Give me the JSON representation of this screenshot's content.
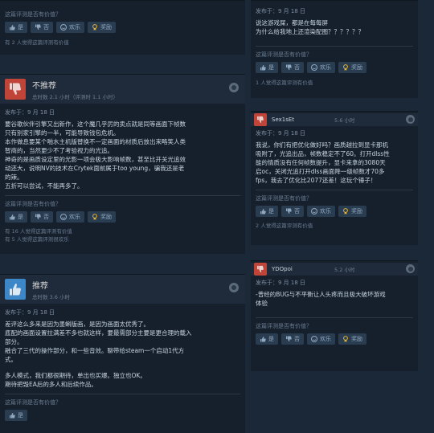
{
  "vote": {
    "question": "这篇评测是否有价值？",
    "yes": "是",
    "no": "否",
    "funny": "欢乐",
    "award": "奖励"
  },
  "top_left": {
    "stats": "有 2 人觉得这篇评测有价值"
  },
  "review1": {
    "verdict": "不推荐",
    "hours": "总时数 2.1 小时（评测时 1.1 小时）",
    "posted": "发布于：9 月 18 日",
    "lines": [
      "要谷歌伙伴引擎又出新作，这个魔几乎厉的卖点就是同等画面下帧数",
      "只有别家引擎的一半，可能导致钱包危机。",
      "本作做息要某个啪水主机版替换不一定画面的材质后放出来略笑人类",
      "智商的，当然更少不了考验视力的光追。",
      "神奇的是画质设定里的光影一项会极大影响帧数，甚至比开关光追效",
      "动还大，说明NV的技术在Crytek面前属于too young，骗我还是老",
      "的辣。",
      "五折可以尝试，不能再多了。"
    ],
    "stats1": "有 16 人觉得这篇评测有价值",
    "stats2": "有 5 人觉得这篇评测很欢乐"
  },
  "review2": {
    "verdict": "推荐",
    "hours": "总时数 3.6 小时",
    "posted": "发布于：9 月 18 日",
    "lines": [
      "差评这么多来是因为墨蝌版画，是因为画面太优秀了。",
      "底配的画面设置拉满差不多也就这样，要最需部分主要是更合理的载入",
      "部分。",
      "融合了三代的操作部分，和一些音效。聊带给steam一个启动1代方",
      "式。",
      "",
      "多人模式，我们都很期待，单出也买爆。独立也OK。",
      "期待把毁EA后的多人和后续作品。"
    ]
  },
  "rc0": {
    "posted": "发布于：9 月 18 日",
    "lines": [
      "说这游戏屎，都是在每每屏",
      "为什么给我地上还渲染配图？？？？？？"
    ],
    "stats": "1 人觉得这篇评测有价值"
  },
  "rc1": {
    "name": "Sex1sEt",
    "hours": "5.6 小时",
    "posted": "发布于：9 月 18 日",
    "lines": [
      "我说，你们有把优化做好吗？画质越拉到显卡那机",
      "吸附了，光追出品，帧数稳定不了60。打开dlss性",
      "能的情质没有任何帧数提升，显卡来拿的3080天",
      "启oc，关闭光追打开dlss画面降一级帧数才70多",
      "fps，我去了优化比2077还差！这玩个锤子！"
    ],
    "stats": "2 人觉得这篇评测有价值"
  },
  "rc2": {
    "name": "YDOpoi",
    "hours": "5.2 小时",
    "posted": "发布于：9 月 18 日",
    "lines": [
      "-曾经的BUG与不平衡让人头疼而且极大破坏游戏",
      "体验"
    ]
  },
  "colors": {
    "page_bg": "#1b2838",
    "card_bg": "#16202d",
    "head_bg": "#1f2b3a",
    "thumb_down": "#c14439",
    "thumb_up": "#3c87c7",
    "award_gold": "#e3b53a",
    "text": "#c6d4df"
  }
}
